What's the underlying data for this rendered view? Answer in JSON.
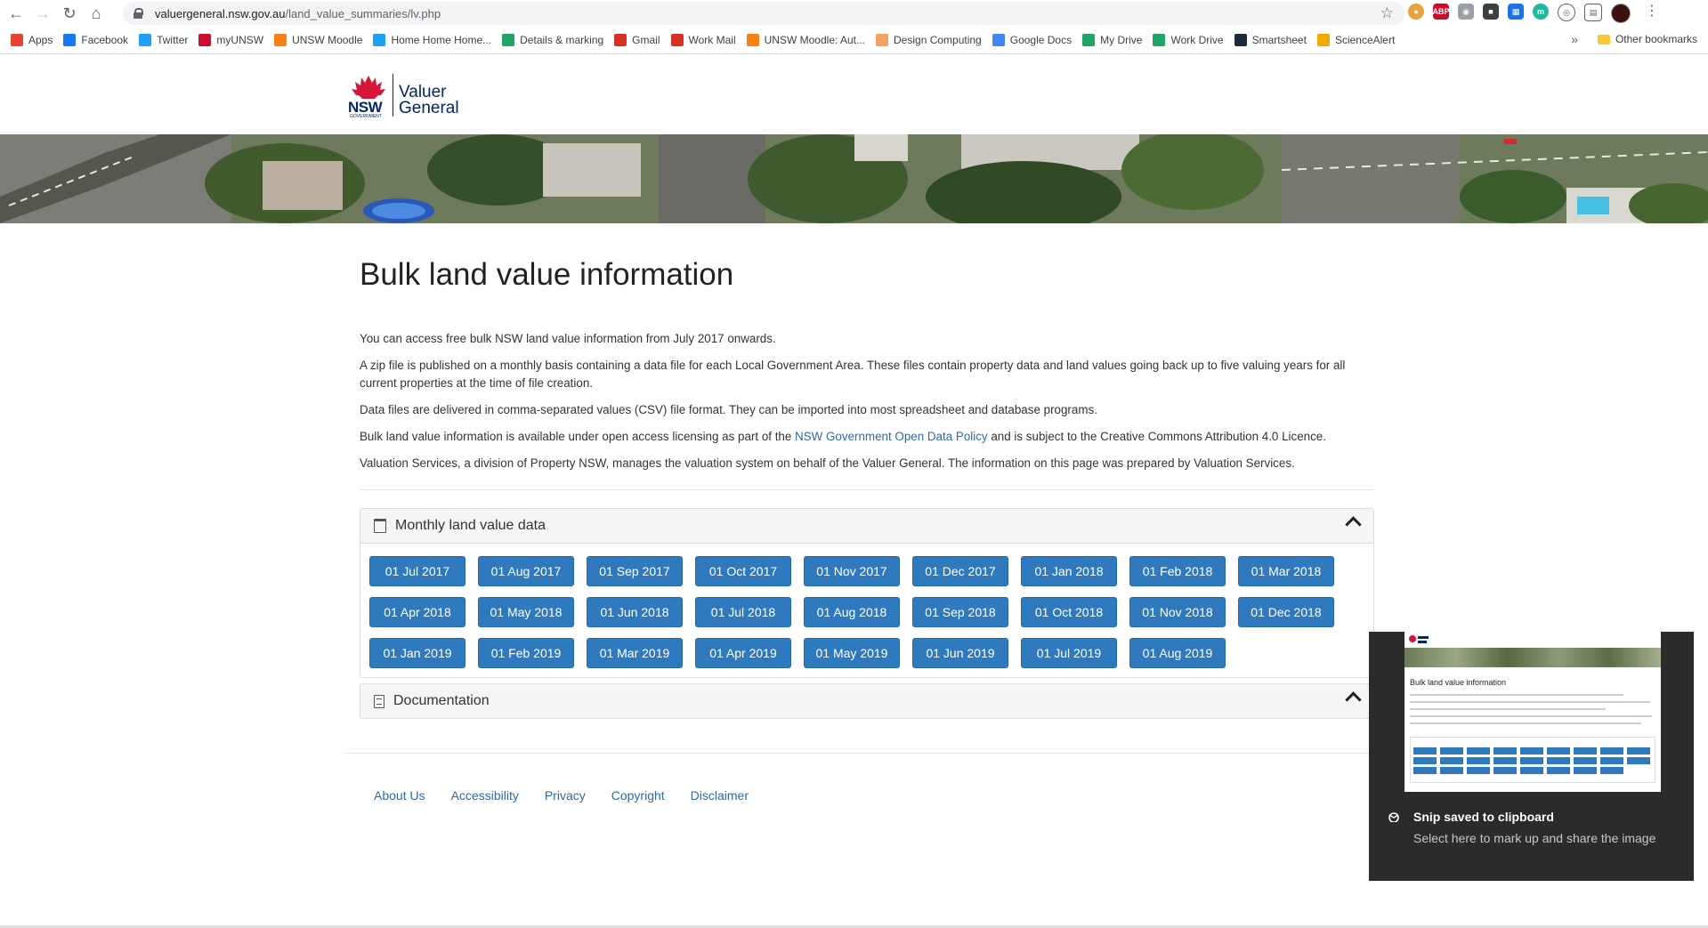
{
  "browser": {
    "url_domain": "valuergeneral.nsw.gov.au",
    "url_path": "/land_value_summaries/lv.php",
    "bookmarks": [
      {
        "label": "Apps",
        "icon": "apps-grid-icon",
        "color": "#e94235"
      },
      {
        "label": "Facebook",
        "icon": "facebook-icon",
        "color": "#1877f2"
      },
      {
        "label": "Twitter",
        "icon": "twitter-icon",
        "color": "#1da1f2"
      },
      {
        "label": "myUNSW",
        "icon": "unsw-shield-icon",
        "color": "#c8102e"
      },
      {
        "label": "UNSW Moodle",
        "icon": "moodle-icon",
        "color": "#f98012"
      },
      {
        "label": "Home Home Home...",
        "icon": "twitter-icon",
        "color": "#1da1f2"
      },
      {
        "label": "Details & marking",
        "icon": "drive-icon",
        "color": "#1fa463"
      },
      {
        "label": "Gmail",
        "icon": "gmail-icon",
        "color": "#d93025"
      },
      {
        "label": "Work Mail",
        "icon": "gmail-icon",
        "color": "#d93025"
      },
      {
        "label": "UNSW Moodle: Aut...",
        "icon": "moodle-icon",
        "color": "#f98012"
      },
      {
        "label": "Design Computing",
        "icon": "sun-icon",
        "color": "#f4a261"
      },
      {
        "label": "Google Docs",
        "icon": "docs-icon",
        "color": "#4285f4"
      },
      {
        "label": "My Drive",
        "icon": "drive-icon",
        "color": "#1fa463"
      },
      {
        "label": "Work Drive",
        "icon": "drive-icon",
        "color": "#1fa463"
      },
      {
        "label": "Smartsheet",
        "icon": "smartsheet-icon",
        "color": "#1b2a3a"
      },
      {
        "label": "ScienceAlert",
        "icon": "sciencealert-icon",
        "color": "#f2a900"
      }
    ],
    "other_bookmarks": "Other bookmarks",
    "more": "»"
  },
  "logo": {
    "nsw": "NSW",
    "government": "GOVERNMENT",
    "line1": "Valuer",
    "line2": "General"
  },
  "page": {
    "title": "Bulk land value information",
    "p1": "You can access free bulk NSW land value information from July 2017 onwards.",
    "p2": "A zip file is published on a monthly basis containing a data file for each Local Government Area. These files contain property data and land values going back up to five valuing years for all current properties at the time of file creation.",
    "p3": "Data files are delivered in comma-separated values (CSV) file format. They can be imported into most spreadsheet and database programs.",
    "p4_before": "Bulk land value information is available under open access licensing as part of the ",
    "p4_link": "NSW Government Open Data Policy",
    "p4_after": " and is subject to the Creative Commons Attribution 4.0 Licence.",
    "p5": "Valuation Services, a division of Property NSW, manages the valuation system on behalf of the Valuer General. The information on this page was prepared by Valuation Services."
  },
  "monthly_panel": {
    "title": "Monthly land value data",
    "dates": [
      "01 Jul 2017",
      "01 Aug 2017",
      "01 Sep 2017",
      "01 Oct 2017",
      "01 Nov 2017",
      "01 Dec 2017",
      "01 Jan 2018",
      "01 Feb 2018",
      "01 Mar 2018",
      "01 Apr 2018",
      "01 May 2018",
      "01 Jun 2018",
      "01 Jul 2018",
      "01 Aug 2018",
      "01 Sep 2018",
      "01 Oct 2018",
      "01 Nov 2018",
      "01 Dec 2018",
      "01 Jan 2019",
      "01 Feb 2019",
      "01 Mar 2019",
      "01 Apr 2019",
      "01 May 2019",
      "01 Jun 2019",
      "01 Jul 2019",
      "01 Aug 2019"
    ]
  },
  "documentation_panel": {
    "title": "Documentation"
  },
  "footer": {
    "links": [
      "About Us",
      "Accessibility",
      "Privacy",
      "Copyright",
      "Disclaimer"
    ]
  },
  "toast": {
    "title": "Snip saved to clipboard",
    "subtitle": "Select here to mark up and share the image",
    "thumb_title": "Bulk land value information"
  },
  "colors": {
    "button_blue": "#2f7abf",
    "link_blue": "#2e6aa6",
    "nsw_navy": "#002664",
    "nsw_red": "#d7153a"
  }
}
